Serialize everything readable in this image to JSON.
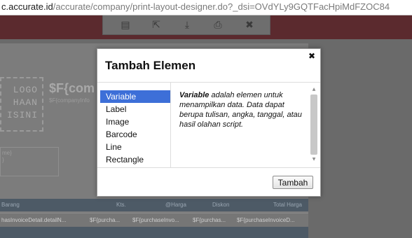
{
  "browser": {
    "url_host": "c.accurate.id",
    "url_rest": "/accurate/company/print-layout-designer.do?_dsi=OVdYLy9GQTFacHpiMdFZOC84"
  },
  "toolbar": {
    "icons": [
      "save-icon",
      "export-icon",
      "download-icon",
      "preview-icon",
      "close-icon"
    ],
    "glyphs": [
      "▤",
      "⇱",
      "⤓",
      "⎙",
      "✖"
    ]
  },
  "designer": {
    "logo_lines": [
      "LOGO",
      "HAAN",
      "ISINI"
    ],
    "company_var": "$F{com",
    "company_sub": "$F{companyInfo",
    "ghost_lines": [
      "me}",
      "}"
    ],
    "table_headers": [
      "Barang",
      "Kts.",
      "@Harga",
      "Diskon",
      "Total Harga"
    ],
    "table_row": [
      "hasInvoiceDetail.detailN...",
      "$F{purcha...",
      "$F{purchaseInvo...",
      "$F{purchas...",
      "$F{purchaseInvoiceD..."
    ]
  },
  "modal": {
    "title": "Tambah Elemen",
    "close_glyph": "✖",
    "items": [
      "Variable",
      "Label",
      "Image",
      "Barcode",
      "Line",
      "Rectangle"
    ],
    "selected_index": 0,
    "description_bold": "Variable",
    "description_rest": " adalah elemen untuk menampilkan data. Data dapat berupa tulisan, angka, tanggal, atau hasil olahan script.",
    "add_button": "Tambah",
    "scroll_up_glyph": "▲",
    "scroll_down_glyph": "▼"
  }
}
